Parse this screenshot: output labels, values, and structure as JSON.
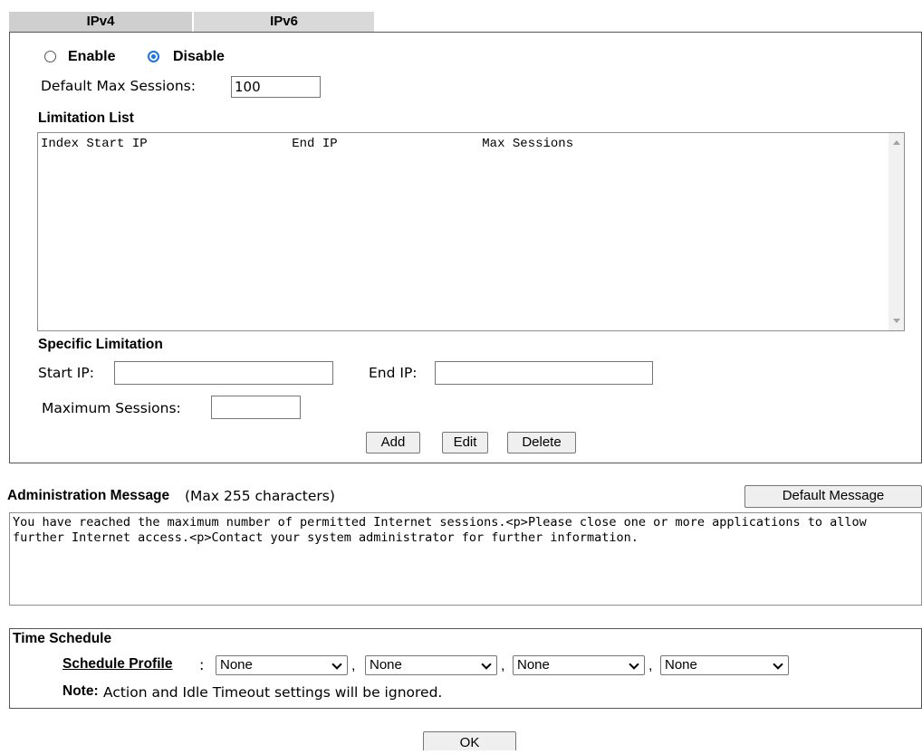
{
  "tabs": [
    {
      "label": "IPv4"
    },
    {
      "label": "IPv6"
    }
  ],
  "mode": {
    "enable_label": "Enable",
    "disable_label": "Disable",
    "selected": "Disable"
  },
  "default_max": {
    "label": "Default Max Sessions:",
    "value": "100"
  },
  "limitation_list": {
    "title": "Limitation List",
    "header": "Index Start IP                   End IP                   Max Sessions"
  },
  "specific": {
    "title": "Specific Limitation",
    "start_ip_label": "Start IP:",
    "end_ip_label": "End IP:",
    "max_sessions_label": "Maximum Sessions:",
    "add": "Add",
    "edit": "Edit",
    "delete": "Delete"
  },
  "admin_message": {
    "title": "Administration Message",
    "subtitle": "(Max 255 characters)",
    "default_button": "Default Message",
    "text": "You have reached the maximum number of permitted Internet sessions.<p>Please close one or more applications to allow further Internet access.<p>Contact your system administrator for further information."
  },
  "time_schedule": {
    "title": "Time Schedule",
    "profile_label": "Schedule Profile",
    "colon": ":",
    "selects": [
      "None",
      "None",
      "None",
      "None"
    ],
    "note_label": "Note:",
    "note_text": "Action and Idle Timeout settings will be ignored."
  },
  "ok_button": "OK"
}
